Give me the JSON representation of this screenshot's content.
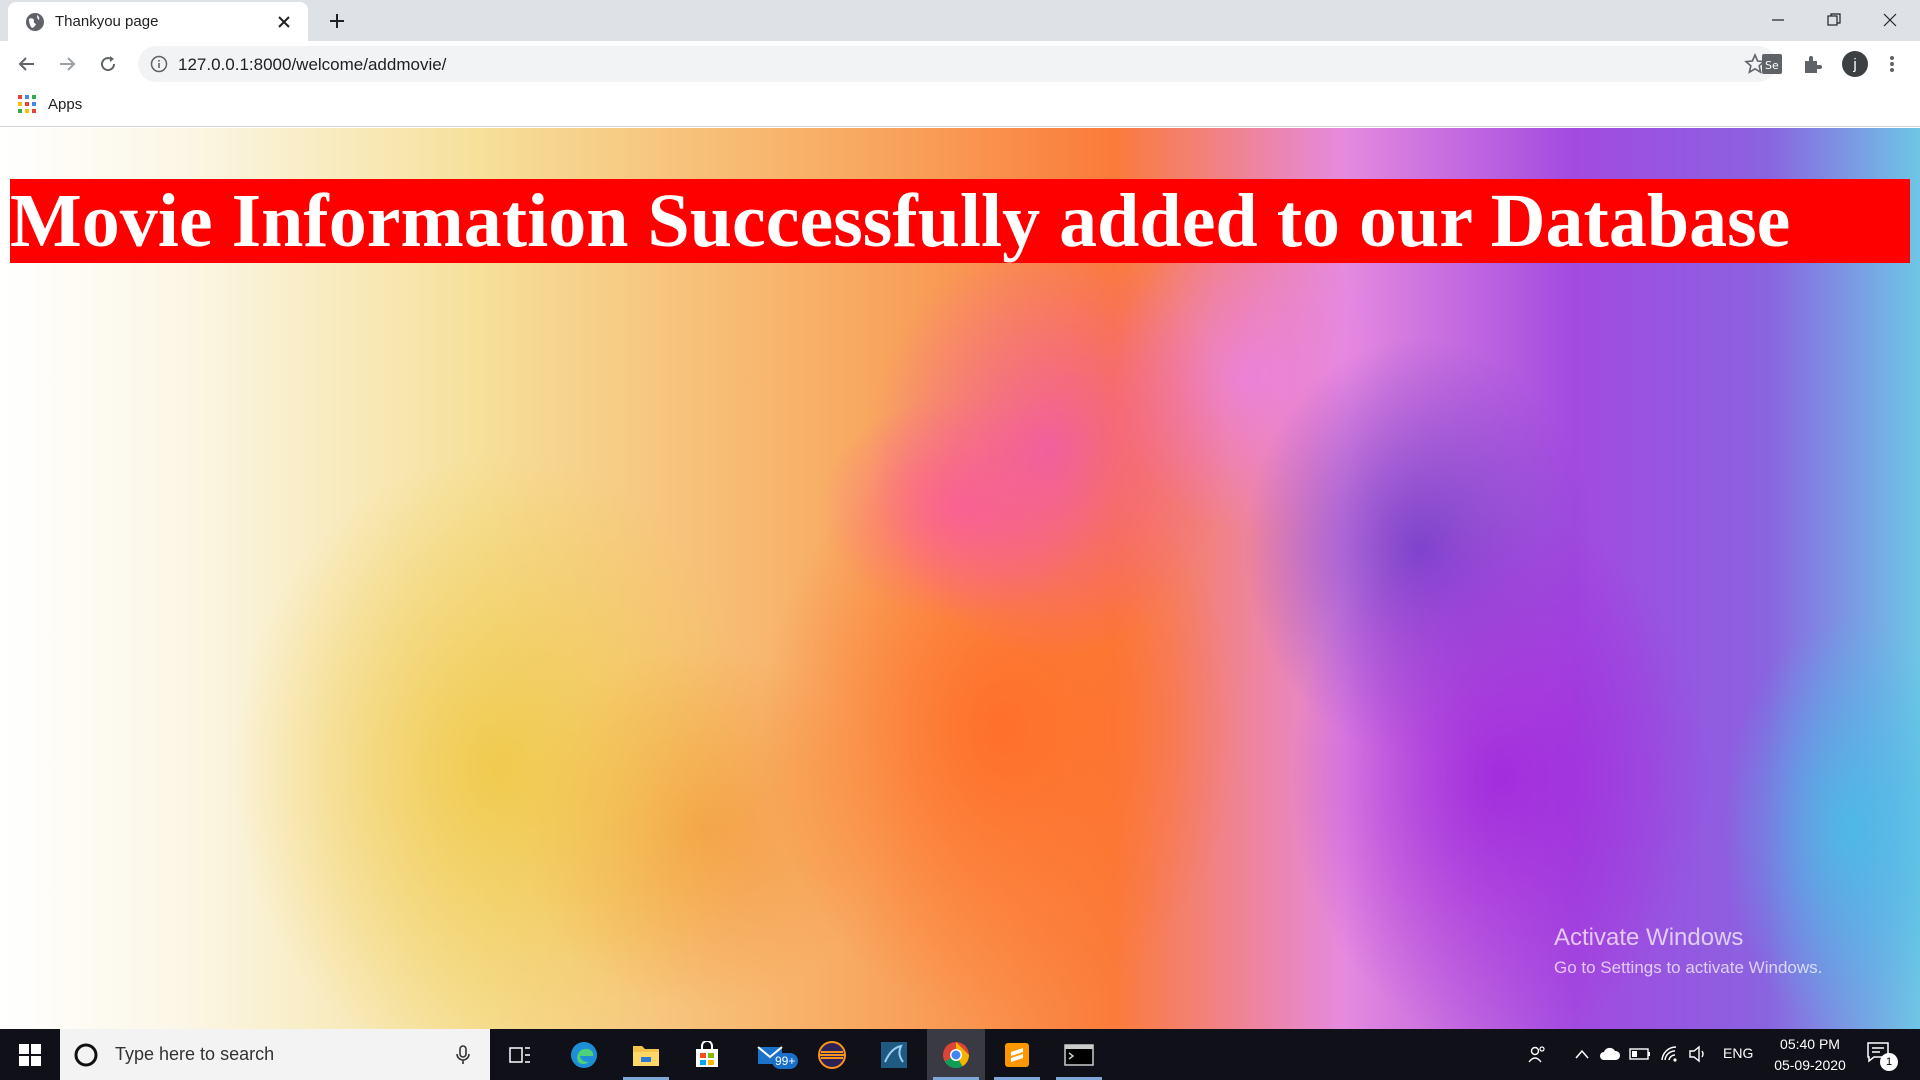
{
  "browser": {
    "tab_title": "Thankyou page",
    "url": "127.0.0.1:8000/welcome/addmovie/",
    "profile_initial": "j",
    "bookmarks": {
      "apps_label": "Apps"
    }
  },
  "page": {
    "heading": "Movie Information Successfully added to our Database",
    "heading_bg": "#ff0000",
    "heading_color": "#ffffff"
  },
  "watermark": {
    "line1": "Activate Windows",
    "line2": "Go to Settings to activate Windows."
  },
  "taskbar": {
    "search_placeholder": "Type here to search",
    "mail_badge": "99+",
    "language": "ENG",
    "time": "05:40 PM",
    "date": "05-09-2020",
    "notification_count": "1"
  }
}
